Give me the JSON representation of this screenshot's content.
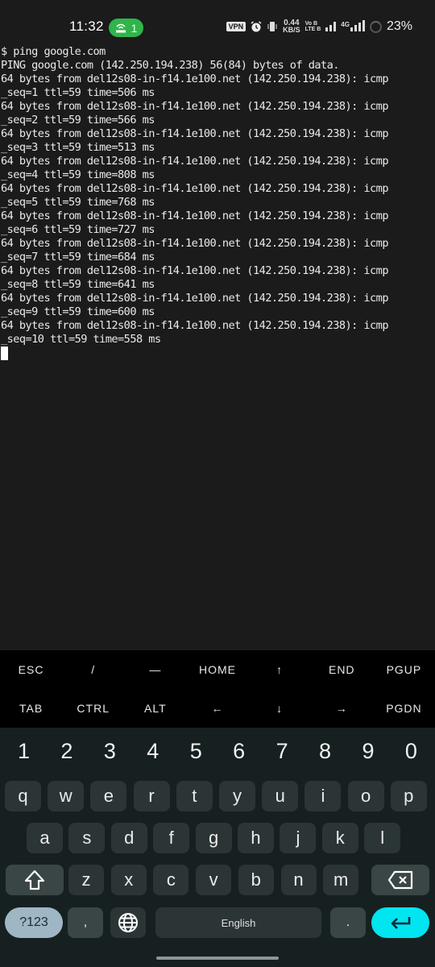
{
  "status_bar": {
    "time": "11:32",
    "hotspot_count": "1",
    "vpn_label": "VPN",
    "net_speed_value": "0.44",
    "net_speed_unit": "KB/S",
    "volte_top": "Vo B",
    "volte_bottom": "LTE B",
    "network_type": "4G",
    "battery_percent": "23%",
    "icons": [
      "hotspot-icon",
      "vpn-icon",
      "alarm-icon",
      "vibrate-icon",
      "signal-icon",
      "signal-4g-icon",
      "battery-icon"
    ]
  },
  "terminal": {
    "lines": [
      "$ ping google.com",
      "PING google.com (142.250.194.238) 56(84) bytes of data.",
      "64 bytes from del12s08-in-f14.1e100.net (142.250.194.238): icmp",
      "_seq=1 ttl=59 time=506 ms",
      "64 bytes from del12s08-in-f14.1e100.net (142.250.194.238): icmp",
      "_seq=2 ttl=59 time=566 ms",
      "64 bytes from del12s08-in-f14.1e100.net (142.250.194.238): icmp",
      "_seq=3 ttl=59 time=513 ms",
      "64 bytes from del12s08-in-f14.1e100.net (142.250.194.238): icmp",
      "_seq=4 ttl=59 time=808 ms",
      "64 bytes from del12s08-in-f14.1e100.net (142.250.194.238): icmp",
      "_seq=5 ttl=59 time=768 ms",
      "64 bytes from del12s08-in-f14.1e100.net (142.250.194.238): icmp",
      "_seq=6 ttl=59 time=727 ms",
      "64 bytes from del12s08-in-f14.1e100.net (142.250.194.238): icmp",
      "_seq=7 ttl=59 time=684 ms",
      "64 bytes from del12s08-in-f14.1e100.net (142.250.194.238): icmp",
      "_seq=8 ttl=59 time=641 ms",
      "64 bytes from del12s08-in-f14.1e100.net (142.250.194.238): icmp",
      "_seq=9 ttl=59 time=600 ms",
      "64 bytes from del12s08-in-f14.1e100.net (142.250.194.238): icmp",
      "_seq=10 ttl=59 time=558 ms"
    ]
  },
  "extra_keys": {
    "row1": [
      "ESC",
      "/",
      "—",
      "HOME",
      "↑",
      "END",
      "PGUP"
    ],
    "row2": [
      "TAB",
      "CTRL",
      "ALT",
      "←",
      "↓",
      "→",
      "PGDN"
    ]
  },
  "keyboard": {
    "numbers": [
      "1",
      "2",
      "3",
      "4",
      "5",
      "6",
      "7",
      "8",
      "9",
      "0"
    ],
    "row1": [
      "q",
      "w",
      "e",
      "r",
      "t",
      "y",
      "u",
      "i",
      "o",
      "p"
    ],
    "row2": [
      "a",
      "s",
      "d",
      "f",
      "g",
      "h",
      "j",
      "k",
      "l"
    ],
    "row3": [
      "z",
      "x",
      "c",
      "v",
      "b",
      "n",
      "m"
    ],
    "symbols_label": "?123",
    "comma_label": ",",
    "space_label": "English",
    "period_label": ".",
    "colors": {
      "enter_key": "#00e5f0",
      "symbols_key": "#9fb6c4",
      "key_bg": "#2b3535",
      "keyboard_bg": "#162020"
    }
  },
  "colors": {
    "terminal_bg": "#1b1b1b",
    "terminal_fg": "#eaeaea",
    "hotspot_badge": "#2fb54a"
  }
}
